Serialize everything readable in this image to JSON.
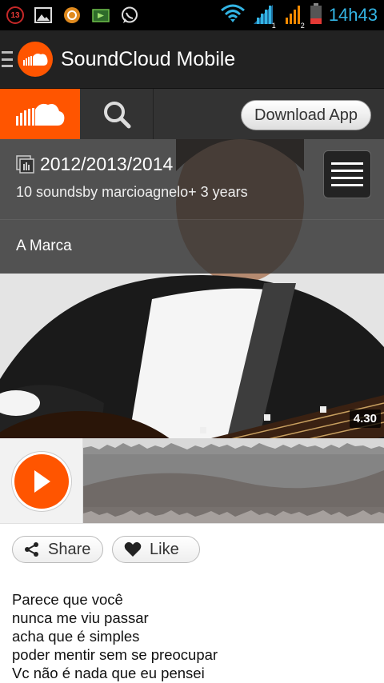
{
  "status_bar": {
    "notification_count": "13",
    "time": "14h43",
    "sim_labels": [
      "1",
      "2"
    ]
  },
  "action_bar": {
    "title": "SoundCloud Mobile"
  },
  "tabs": {
    "download_label": "Download App"
  },
  "set": {
    "title": "2012/2013/2014",
    "meta": "10 soundsby marcioagnelo+ 3 years"
  },
  "track": {
    "title": "A Marca",
    "duration": "4.30"
  },
  "social": {
    "share_label": "Share",
    "like_label": "Like"
  },
  "lyrics": [
    "Parece que você",
    "nunca me viu passar",
    "acha que é simples",
    "poder mentir sem se preocupar",
    "Vc não é nada que eu pensei"
  ],
  "colors": {
    "brand_orange": "#ff5500",
    "status_blue": "#33b5e5",
    "action_bar": "#222222"
  }
}
